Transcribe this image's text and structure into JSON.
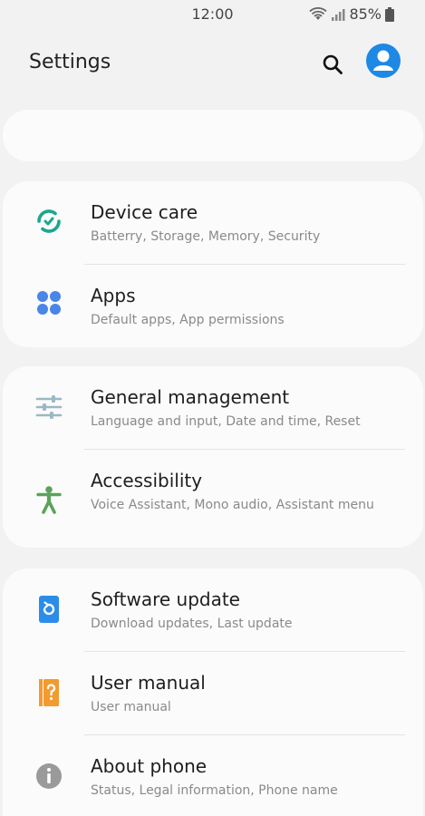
{
  "status": {
    "time": "12:00",
    "battery": "85%"
  },
  "header": {
    "title": "Settings"
  },
  "items": [
    {
      "title": "Device care",
      "subtitle": "Batterry, Storage, Memory, Security",
      "icon": "device-care-icon",
      "color": "#1aa88e"
    },
    {
      "title": "Apps",
      "subtitle": "Default apps, App permissions",
      "icon": "apps-icon",
      "color": "#4a86e8"
    },
    {
      "title": "General management",
      "subtitle": "Language and input, Date and time, Reset",
      "icon": "sliders-icon",
      "color": "#9bb8c4"
    },
    {
      "title": "Accessibility",
      "subtitle": "Voice Assistant, Mono audio, Assistant menu",
      "icon": "accessibility-icon",
      "color": "#5aa35a"
    },
    {
      "title": "Software update",
      "subtitle": "Download updates, Last update",
      "icon": "software-update-icon",
      "color": "#2b8de8"
    },
    {
      "title": "User manual",
      "subtitle": "User manual",
      "icon": "user-manual-icon",
      "color": "#f29b30"
    },
    {
      "title": "About phone",
      "subtitle": "Status, Legal information, Phone name",
      "icon": "info-icon",
      "color": "#9a9a9a"
    }
  ]
}
